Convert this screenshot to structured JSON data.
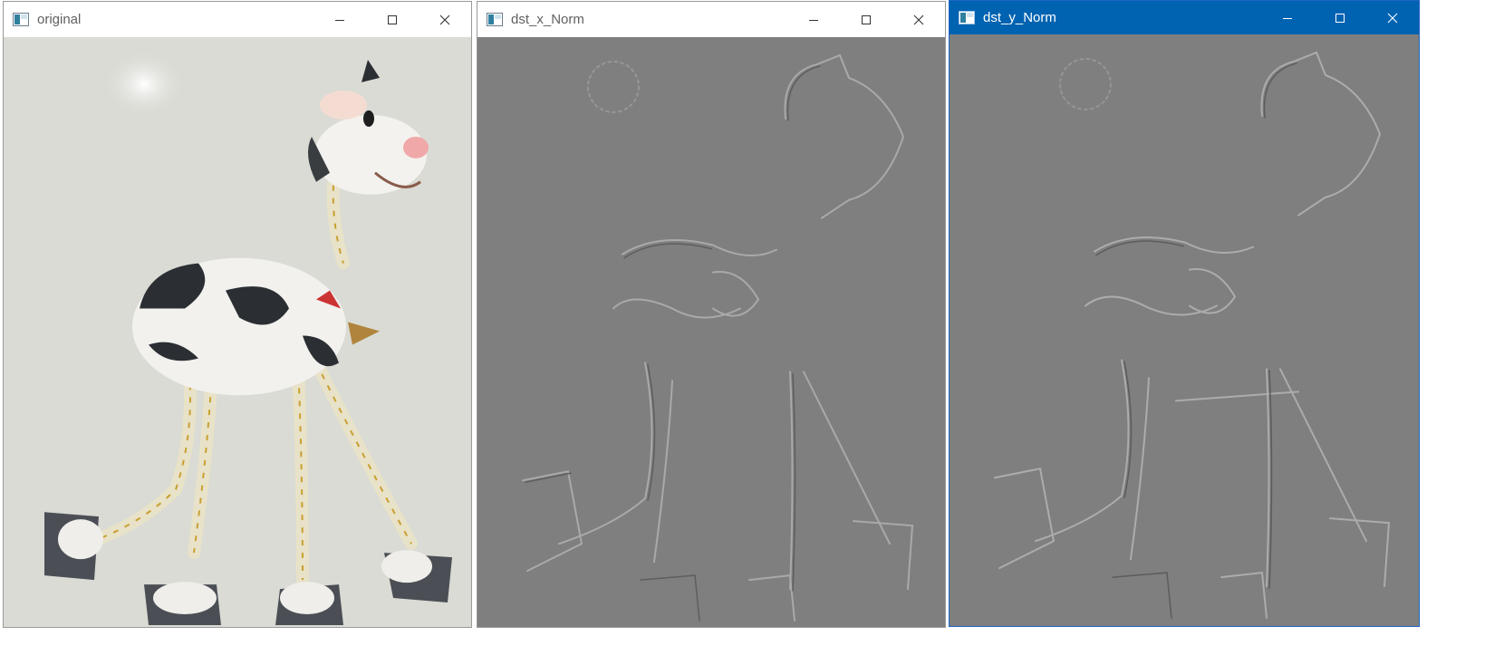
{
  "windows": [
    {
      "title": "original",
      "active": false
    },
    {
      "title": "dst_x_Norm",
      "active": false
    },
    {
      "title": "dst_y_Norm",
      "active": true
    }
  ],
  "colors": {
    "active_titlebar": "#0063b1",
    "edge_gray": "#7f7f7f",
    "wall": "#dcdcd6"
  },
  "icons": [
    "app-icon",
    "minimize-icon",
    "maximize-icon",
    "close-icon"
  ]
}
